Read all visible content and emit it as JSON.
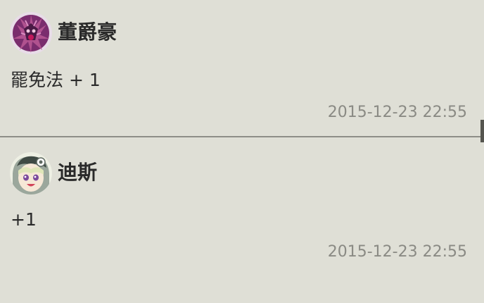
{
  "comments": [
    {
      "username": "董爵豪",
      "text": "罷免法 + 1",
      "timestamp": "2015-12-23 22:55",
      "avatar_icon": "dragon-avatar"
    },
    {
      "username": "迪斯",
      "text": "+1",
      "timestamp": "2015-12-23 22:55",
      "avatar_icon": "anime-girl-avatar"
    }
  ],
  "colors": {
    "background": "#dfdfd6",
    "divider": "#8e8e88",
    "timestamp": "#8a8a84"
  }
}
